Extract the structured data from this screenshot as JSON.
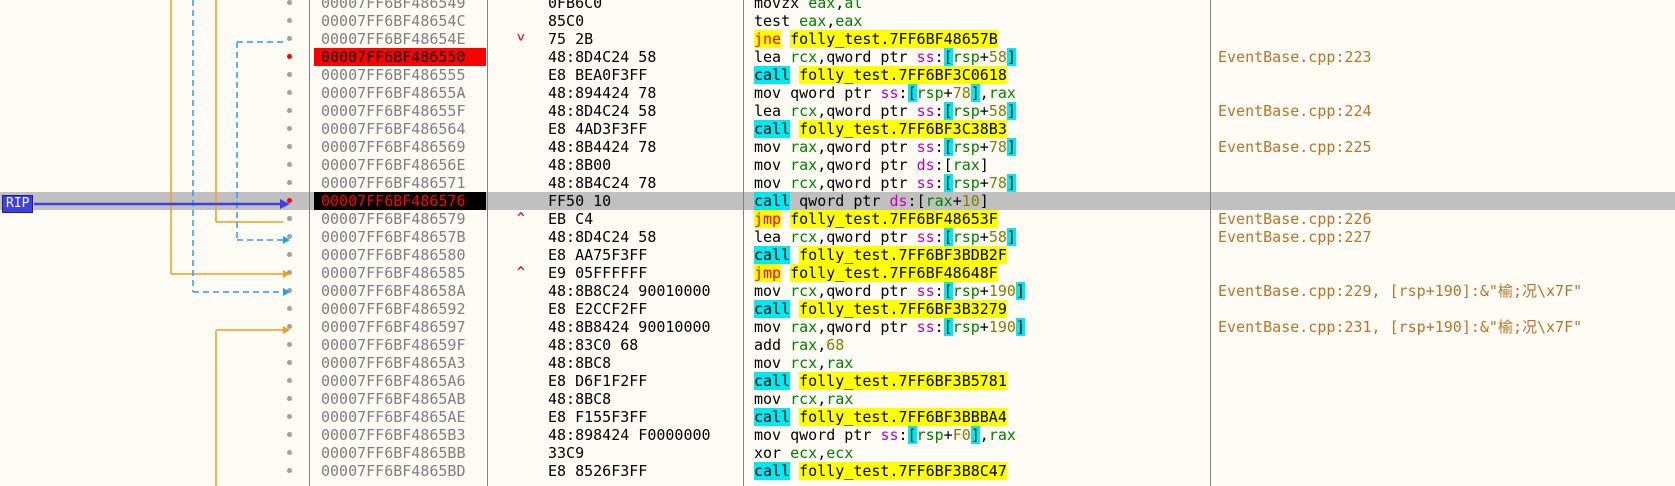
{
  "rip_label": "RIP",
  "colors": {
    "breakpoint": "#ff0000",
    "rip_address_bg": "#000000",
    "current_row": "#c0c0c0",
    "call_highlight": "#00e8f0",
    "jump_highlight": "#ffff00",
    "branch_arrow": "#f0a020",
    "dashed_arrow": "#20a0f0",
    "rip_arrow": "#4040e0"
  },
  "icons": {
    "breakpoint_dot": "breakpoint-dot-icon",
    "jump_up": "jump-up-arrow-icon",
    "jump_down": "jump-down-arrow-icon"
  },
  "rows": [
    {
      "address": "00007FF6BF486549",
      "bytes": "0FB6C0",
      "mnemonic": "movzx",
      "kind": "plain",
      "ops": [
        [
          "reg",
          "eax"
        ],
        [
          "op",
          ","
        ],
        [
          "reg",
          "al"
        ]
      ],
      "comment": "",
      "state": ""
    },
    {
      "address": "00007FF6BF48654C",
      "bytes": "85C0",
      "mnemonic": "test",
      "kind": "plain",
      "ops": [
        [
          "reg",
          "eax"
        ],
        [
          "op",
          ","
        ],
        [
          "reg",
          "eax"
        ]
      ],
      "comment": "",
      "state": ""
    },
    {
      "address": "00007FF6BF48654E",
      "bytes": "75 2B",
      "mnemonic": "jne",
      "kind": "jmp",
      "ops": [
        [
          "target",
          "folly_test.7FF6BF48657B"
        ]
      ],
      "comment": "",
      "state": "",
      "jump": "down"
    },
    {
      "address": "00007FF6BF486550",
      "bytes": "48:8D4C24 58",
      "mnemonic": "lea",
      "kind": "plain",
      "ops": [
        [
          "reg",
          "rcx"
        ],
        [
          "op",
          ","
        ],
        [
          "sz",
          "qword ptr "
        ],
        [
          "seg",
          "ss"
        ],
        [
          "op",
          ":"
        ],
        [
          "br",
          "["
        ],
        [
          "reg",
          "rsp"
        ],
        [
          "op",
          "+"
        ],
        [
          "num",
          "58"
        ],
        [
          "br",
          "]"
        ]
      ],
      "comment": "EventBase.cpp:223",
      "state": "bp"
    },
    {
      "address": "00007FF6BF486555",
      "bytes": "E8 BEA0F3FF",
      "mnemonic": "call",
      "kind": "call",
      "ops": [
        [
          "target",
          "folly_test.7FF6BF3C0618"
        ]
      ],
      "comment": "",
      "state": ""
    },
    {
      "address": "00007FF6BF48655A",
      "bytes": "48:894424 78",
      "mnemonic": "mov",
      "kind": "plain",
      "ops": [
        [
          "sz",
          "qword ptr "
        ],
        [
          "seg",
          "ss"
        ],
        [
          "op",
          ":"
        ],
        [
          "br",
          "["
        ],
        [
          "reg",
          "rsp"
        ],
        [
          "op",
          "+"
        ],
        [
          "num",
          "78"
        ],
        [
          "br",
          "]"
        ],
        [
          "op",
          ","
        ],
        [
          "reg",
          "rax"
        ]
      ],
      "comment": "",
      "state": ""
    },
    {
      "address": "00007FF6BF48655F",
      "bytes": "48:8D4C24 58",
      "mnemonic": "lea",
      "kind": "plain",
      "ops": [
        [
          "reg",
          "rcx"
        ],
        [
          "op",
          ","
        ],
        [
          "sz",
          "qword ptr "
        ],
        [
          "seg",
          "ss"
        ],
        [
          "op",
          ":"
        ],
        [
          "br",
          "["
        ],
        [
          "reg",
          "rsp"
        ],
        [
          "op",
          "+"
        ],
        [
          "num",
          "58"
        ],
        [
          "br",
          "]"
        ]
      ],
      "comment": "EventBase.cpp:224",
      "state": ""
    },
    {
      "address": "00007FF6BF486564",
      "bytes": "E8 4AD3F3FF",
      "mnemonic": "call",
      "kind": "call",
      "ops": [
        [
          "target",
          "folly_test.7FF6BF3C38B3"
        ]
      ],
      "comment": "",
      "state": ""
    },
    {
      "address": "00007FF6BF486569",
      "bytes": "48:8B4424 78",
      "mnemonic": "mov",
      "kind": "plain",
      "ops": [
        [
          "reg",
          "rax"
        ],
        [
          "op",
          ","
        ],
        [
          "sz",
          "qword ptr "
        ],
        [
          "seg",
          "ss"
        ],
        [
          "op",
          ":"
        ],
        [
          "br",
          "["
        ],
        [
          "reg",
          "rsp"
        ],
        [
          "op",
          "+"
        ],
        [
          "num",
          "78"
        ],
        [
          "br",
          "]"
        ]
      ],
      "comment": "EventBase.cpp:225",
      "state": ""
    },
    {
      "address": "00007FF6BF48656E",
      "bytes": "48:8B00",
      "mnemonic": "mov",
      "kind": "plain",
      "ops": [
        [
          "reg",
          "rax"
        ],
        [
          "op",
          ","
        ],
        [
          "sz",
          "qword ptr "
        ],
        [
          "seg",
          "ds"
        ],
        [
          "op",
          ":"
        ],
        [
          "brk",
          "["
        ],
        [
          "reg",
          "rax"
        ],
        [
          "brk",
          "]"
        ]
      ],
      "comment": "",
      "state": ""
    },
    {
      "address": "00007FF6BF486571",
      "bytes": "48:8B4C24 78",
      "mnemonic": "mov",
      "kind": "plain",
      "ops": [
        [
          "reg",
          "rcx"
        ],
        [
          "op",
          ","
        ],
        [
          "sz",
          "qword ptr "
        ],
        [
          "seg",
          "ss"
        ],
        [
          "op",
          ":"
        ],
        [
          "br",
          "["
        ],
        [
          "reg",
          "rsp"
        ],
        [
          "op",
          "+"
        ],
        [
          "num",
          "78"
        ],
        [
          "br",
          "]"
        ]
      ],
      "comment": "",
      "state": ""
    },
    {
      "address": "00007FF6BF486576",
      "bytes": "FF50 10",
      "mnemonic": "call",
      "kind": "call-indirect",
      "ops": [
        [
          "sz",
          "qword ptr "
        ],
        [
          "seg",
          "ds"
        ],
        [
          "op",
          ":"
        ],
        [
          "brk",
          "["
        ],
        [
          "reg",
          "rax"
        ],
        [
          "op",
          "+"
        ],
        [
          "num",
          "10"
        ],
        [
          "brk",
          "]"
        ]
      ],
      "comment": "",
      "state": "rip"
    },
    {
      "address": "00007FF6BF486579",
      "bytes": "EB C4",
      "mnemonic": "jmp",
      "kind": "jmp",
      "ops": [
        [
          "target",
          "folly_test.7FF6BF48653F"
        ]
      ],
      "comment": "EventBase.cpp:226",
      "state": "",
      "jump": "up"
    },
    {
      "address": "00007FF6BF48657B",
      "bytes": "48:8D4C24 58",
      "mnemonic": "lea",
      "kind": "plain",
      "ops": [
        [
          "reg",
          "rcx"
        ],
        [
          "op",
          ","
        ],
        [
          "sz",
          "qword ptr "
        ],
        [
          "seg",
          "ss"
        ],
        [
          "op",
          ":"
        ],
        [
          "br",
          "["
        ],
        [
          "reg",
          "rsp"
        ],
        [
          "op",
          "+"
        ],
        [
          "num",
          "58"
        ],
        [
          "br",
          "]"
        ]
      ],
      "comment": "EventBase.cpp:227",
      "state": ""
    },
    {
      "address": "00007FF6BF486580",
      "bytes": "E8 AA75F3FF",
      "mnemonic": "call",
      "kind": "call",
      "ops": [
        [
          "target",
          "folly_test.7FF6BF3BDB2F"
        ]
      ],
      "comment": "",
      "state": ""
    },
    {
      "address": "00007FF6BF486585",
      "bytes": "E9 05FFFFFF",
      "mnemonic": "jmp",
      "kind": "jmp",
      "ops": [
        [
          "target",
          "folly_test.7FF6BF48648F"
        ]
      ],
      "comment": "",
      "state": "",
      "jump": "up"
    },
    {
      "address": "00007FF6BF48658A",
      "bytes": "48:8B8C24 90010000",
      "mnemonic": "mov",
      "kind": "plain",
      "ops": [
        [
          "reg",
          "rcx"
        ],
        [
          "op",
          ","
        ],
        [
          "sz",
          "qword ptr "
        ],
        [
          "seg",
          "ss"
        ],
        [
          "op",
          ":"
        ],
        [
          "br",
          "["
        ],
        [
          "reg",
          "rsp"
        ],
        [
          "op",
          "+"
        ],
        [
          "num",
          "190"
        ],
        [
          "br",
          "]"
        ]
      ],
      "comment": "EventBase.cpp:229, [rsp+190]:&\"榆;况\\x7F\"",
      "state": ""
    },
    {
      "address": "00007FF6BF486592",
      "bytes": "E8 E2CCF2FF",
      "mnemonic": "call",
      "kind": "call",
      "ops": [
        [
          "target",
          "folly_test.7FF6BF3B3279"
        ]
      ],
      "comment": "",
      "state": ""
    },
    {
      "address": "00007FF6BF486597",
      "bytes": "48:8B8424 90010000",
      "mnemonic": "mov",
      "kind": "plain",
      "ops": [
        [
          "reg",
          "rax"
        ],
        [
          "op",
          ","
        ],
        [
          "sz",
          "qword ptr "
        ],
        [
          "seg",
          "ss"
        ],
        [
          "op",
          ":"
        ],
        [
          "br",
          "["
        ],
        [
          "reg",
          "rsp"
        ],
        [
          "op",
          "+"
        ],
        [
          "num",
          "190"
        ],
        [
          "br",
          "]"
        ]
      ],
      "comment": "EventBase.cpp:231, [rsp+190]:&\"榆;况\\x7F\"",
      "state": ""
    },
    {
      "address": "00007FF6BF48659F",
      "bytes": "48:83C0 68",
      "mnemonic": "add",
      "kind": "plain",
      "ops": [
        [
          "reg",
          "rax"
        ],
        [
          "op",
          ","
        ],
        [
          "num",
          "68"
        ]
      ],
      "comment": "",
      "state": ""
    },
    {
      "address": "00007FF6BF4865A3",
      "bytes": "48:8BC8",
      "mnemonic": "mov",
      "kind": "plain",
      "ops": [
        [
          "reg",
          "rcx"
        ],
        [
          "op",
          ","
        ],
        [
          "reg",
          "rax"
        ]
      ],
      "comment": "",
      "state": ""
    },
    {
      "address": "00007FF6BF4865A6",
      "bytes": "E8 D6F1F2FF",
      "mnemonic": "call",
      "kind": "call",
      "ops": [
        [
          "target",
          "folly_test.7FF6BF3B5781"
        ]
      ],
      "comment": "",
      "state": ""
    },
    {
      "address": "00007FF6BF4865AB",
      "bytes": "48:8BC8",
      "mnemonic": "mov",
      "kind": "plain",
      "ops": [
        [
          "reg",
          "rcx"
        ],
        [
          "op",
          ","
        ],
        [
          "reg",
          "rax"
        ]
      ],
      "comment": "",
      "state": ""
    },
    {
      "address": "00007FF6BF4865AE",
      "bytes": "E8 F155F3FF",
      "mnemonic": "call",
      "kind": "call",
      "ops": [
        [
          "target",
          "folly_test.7FF6BF3BBBA4"
        ]
      ],
      "comment": "",
      "state": ""
    },
    {
      "address": "00007FF6BF4865B3",
      "bytes": "48:898424 F0000000",
      "mnemonic": "mov",
      "kind": "plain",
      "ops": [
        [
          "sz",
          "qword ptr "
        ],
        [
          "seg",
          "ss"
        ],
        [
          "op",
          ":"
        ],
        [
          "br",
          "["
        ],
        [
          "reg",
          "rsp"
        ],
        [
          "op",
          "+"
        ],
        [
          "num",
          "F0"
        ],
        [
          "br",
          "]"
        ],
        [
          "op",
          ","
        ],
        [
          "reg",
          "rax"
        ]
      ],
      "comment": "",
      "state": ""
    },
    {
      "address": "00007FF6BF4865BB",
      "bytes": "33C9",
      "mnemonic": "xor",
      "kind": "plain",
      "ops": [
        [
          "reg",
          "ecx"
        ],
        [
          "op",
          ","
        ],
        [
          "reg",
          "ecx"
        ]
      ],
      "comment": "",
      "state": ""
    },
    {
      "address": "00007FF6BF4865BD",
      "bytes": "E8 8526F3FF",
      "mnemonic": "call",
      "kind": "call",
      "ops": [
        [
          "target",
          "folly_test.7FF6BF3B8C47"
        ]
      ],
      "comment": "",
      "state": ""
    }
  ]
}
